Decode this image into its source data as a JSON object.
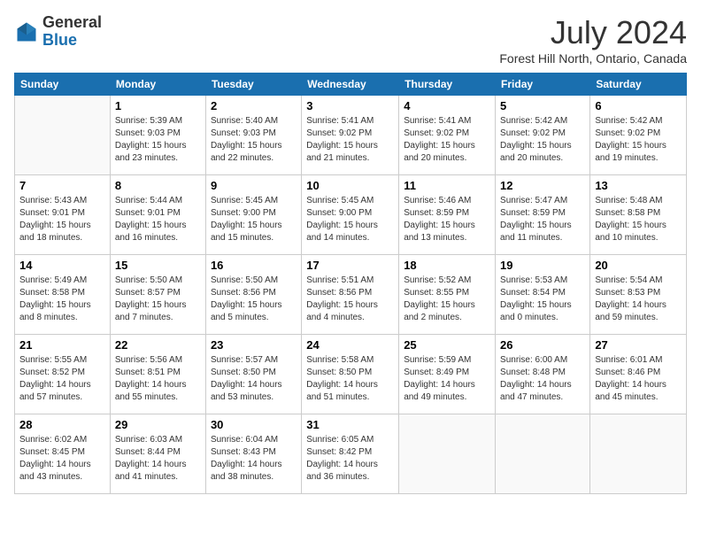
{
  "logo": {
    "general": "General",
    "blue": "Blue"
  },
  "title": "July 2024",
  "location": "Forest Hill North, Ontario, Canada",
  "days_of_week": [
    "Sunday",
    "Monday",
    "Tuesday",
    "Wednesday",
    "Thursday",
    "Friday",
    "Saturday"
  ],
  "weeks": [
    [
      {
        "day": "",
        "info": ""
      },
      {
        "day": "1",
        "info": "Sunrise: 5:39 AM\nSunset: 9:03 PM\nDaylight: 15 hours\nand 23 minutes."
      },
      {
        "day": "2",
        "info": "Sunrise: 5:40 AM\nSunset: 9:03 PM\nDaylight: 15 hours\nand 22 minutes."
      },
      {
        "day": "3",
        "info": "Sunrise: 5:41 AM\nSunset: 9:02 PM\nDaylight: 15 hours\nand 21 minutes."
      },
      {
        "day": "4",
        "info": "Sunrise: 5:41 AM\nSunset: 9:02 PM\nDaylight: 15 hours\nand 20 minutes."
      },
      {
        "day": "5",
        "info": "Sunrise: 5:42 AM\nSunset: 9:02 PM\nDaylight: 15 hours\nand 20 minutes."
      },
      {
        "day": "6",
        "info": "Sunrise: 5:42 AM\nSunset: 9:02 PM\nDaylight: 15 hours\nand 19 minutes."
      }
    ],
    [
      {
        "day": "7",
        "info": "Sunrise: 5:43 AM\nSunset: 9:01 PM\nDaylight: 15 hours\nand 18 minutes."
      },
      {
        "day": "8",
        "info": "Sunrise: 5:44 AM\nSunset: 9:01 PM\nDaylight: 15 hours\nand 16 minutes."
      },
      {
        "day": "9",
        "info": "Sunrise: 5:45 AM\nSunset: 9:00 PM\nDaylight: 15 hours\nand 15 minutes."
      },
      {
        "day": "10",
        "info": "Sunrise: 5:45 AM\nSunset: 9:00 PM\nDaylight: 15 hours\nand 14 minutes."
      },
      {
        "day": "11",
        "info": "Sunrise: 5:46 AM\nSunset: 8:59 PM\nDaylight: 15 hours\nand 13 minutes."
      },
      {
        "day": "12",
        "info": "Sunrise: 5:47 AM\nSunset: 8:59 PM\nDaylight: 15 hours\nand 11 minutes."
      },
      {
        "day": "13",
        "info": "Sunrise: 5:48 AM\nSunset: 8:58 PM\nDaylight: 15 hours\nand 10 minutes."
      }
    ],
    [
      {
        "day": "14",
        "info": "Sunrise: 5:49 AM\nSunset: 8:58 PM\nDaylight: 15 hours\nand 8 minutes."
      },
      {
        "day": "15",
        "info": "Sunrise: 5:50 AM\nSunset: 8:57 PM\nDaylight: 15 hours\nand 7 minutes."
      },
      {
        "day": "16",
        "info": "Sunrise: 5:50 AM\nSunset: 8:56 PM\nDaylight: 15 hours\nand 5 minutes."
      },
      {
        "day": "17",
        "info": "Sunrise: 5:51 AM\nSunset: 8:56 PM\nDaylight: 15 hours\nand 4 minutes."
      },
      {
        "day": "18",
        "info": "Sunrise: 5:52 AM\nSunset: 8:55 PM\nDaylight: 15 hours\nand 2 minutes."
      },
      {
        "day": "19",
        "info": "Sunrise: 5:53 AM\nSunset: 8:54 PM\nDaylight: 15 hours\nand 0 minutes."
      },
      {
        "day": "20",
        "info": "Sunrise: 5:54 AM\nSunset: 8:53 PM\nDaylight: 14 hours\nand 59 minutes."
      }
    ],
    [
      {
        "day": "21",
        "info": "Sunrise: 5:55 AM\nSunset: 8:52 PM\nDaylight: 14 hours\nand 57 minutes."
      },
      {
        "day": "22",
        "info": "Sunrise: 5:56 AM\nSunset: 8:51 PM\nDaylight: 14 hours\nand 55 minutes."
      },
      {
        "day": "23",
        "info": "Sunrise: 5:57 AM\nSunset: 8:50 PM\nDaylight: 14 hours\nand 53 minutes."
      },
      {
        "day": "24",
        "info": "Sunrise: 5:58 AM\nSunset: 8:50 PM\nDaylight: 14 hours\nand 51 minutes."
      },
      {
        "day": "25",
        "info": "Sunrise: 5:59 AM\nSunset: 8:49 PM\nDaylight: 14 hours\nand 49 minutes."
      },
      {
        "day": "26",
        "info": "Sunrise: 6:00 AM\nSunset: 8:48 PM\nDaylight: 14 hours\nand 47 minutes."
      },
      {
        "day": "27",
        "info": "Sunrise: 6:01 AM\nSunset: 8:46 PM\nDaylight: 14 hours\nand 45 minutes."
      }
    ],
    [
      {
        "day": "28",
        "info": "Sunrise: 6:02 AM\nSunset: 8:45 PM\nDaylight: 14 hours\nand 43 minutes."
      },
      {
        "day": "29",
        "info": "Sunrise: 6:03 AM\nSunset: 8:44 PM\nDaylight: 14 hours\nand 41 minutes."
      },
      {
        "day": "30",
        "info": "Sunrise: 6:04 AM\nSunset: 8:43 PM\nDaylight: 14 hours\nand 38 minutes."
      },
      {
        "day": "31",
        "info": "Sunrise: 6:05 AM\nSunset: 8:42 PM\nDaylight: 14 hours\nand 36 minutes."
      },
      {
        "day": "",
        "info": ""
      },
      {
        "day": "",
        "info": ""
      },
      {
        "day": "",
        "info": ""
      }
    ]
  ]
}
